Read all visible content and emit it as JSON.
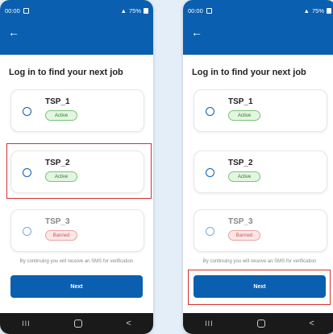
{
  "screens": [
    {
      "status_time": "00:00",
      "status_right": "75%",
      "title": "Log in to find your next job",
      "cards": [
        {
          "name": "TSP_1",
          "badge": "Active"
        },
        {
          "name": "TSP_2",
          "badge": "Active"
        },
        {
          "name": "TSP_3",
          "badge": "Banned"
        }
      ],
      "note": "By continuing you will receive an SMS for verification",
      "next_label": "Next",
      "nav": {
        "recent": "III",
        "back": "<"
      }
    },
    {
      "status_time": "00:00",
      "status_right": "75%",
      "title": "Log in to find your next job",
      "cards": [
        {
          "name": "TSP_1",
          "badge": "Active"
        },
        {
          "name": "TSP_2",
          "badge": "Active"
        },
        {
          "name": "TSP_3",
          "badge": "Banned"
        }
      ],
      "note": "By continuing you will receive an SMS for verification",
      "next_label": "Next",
      "nav": {
        "recent": "III",
        "back": "<"
      }
    }
  ],
  "icons": {
    "back": "arrow-left-icon",
    "radio": "radio-unselected-icon",
    "home": "home-nav-icon"
  },
  "colors": {
    "primary": "#0a5fb0",
    "active_badge": "#2d7a2b",
    "banned_badge": "#c45b5b",
    "highlight": "#d32f2f",
    "page_bg": "#e4eef9"
  }
}
